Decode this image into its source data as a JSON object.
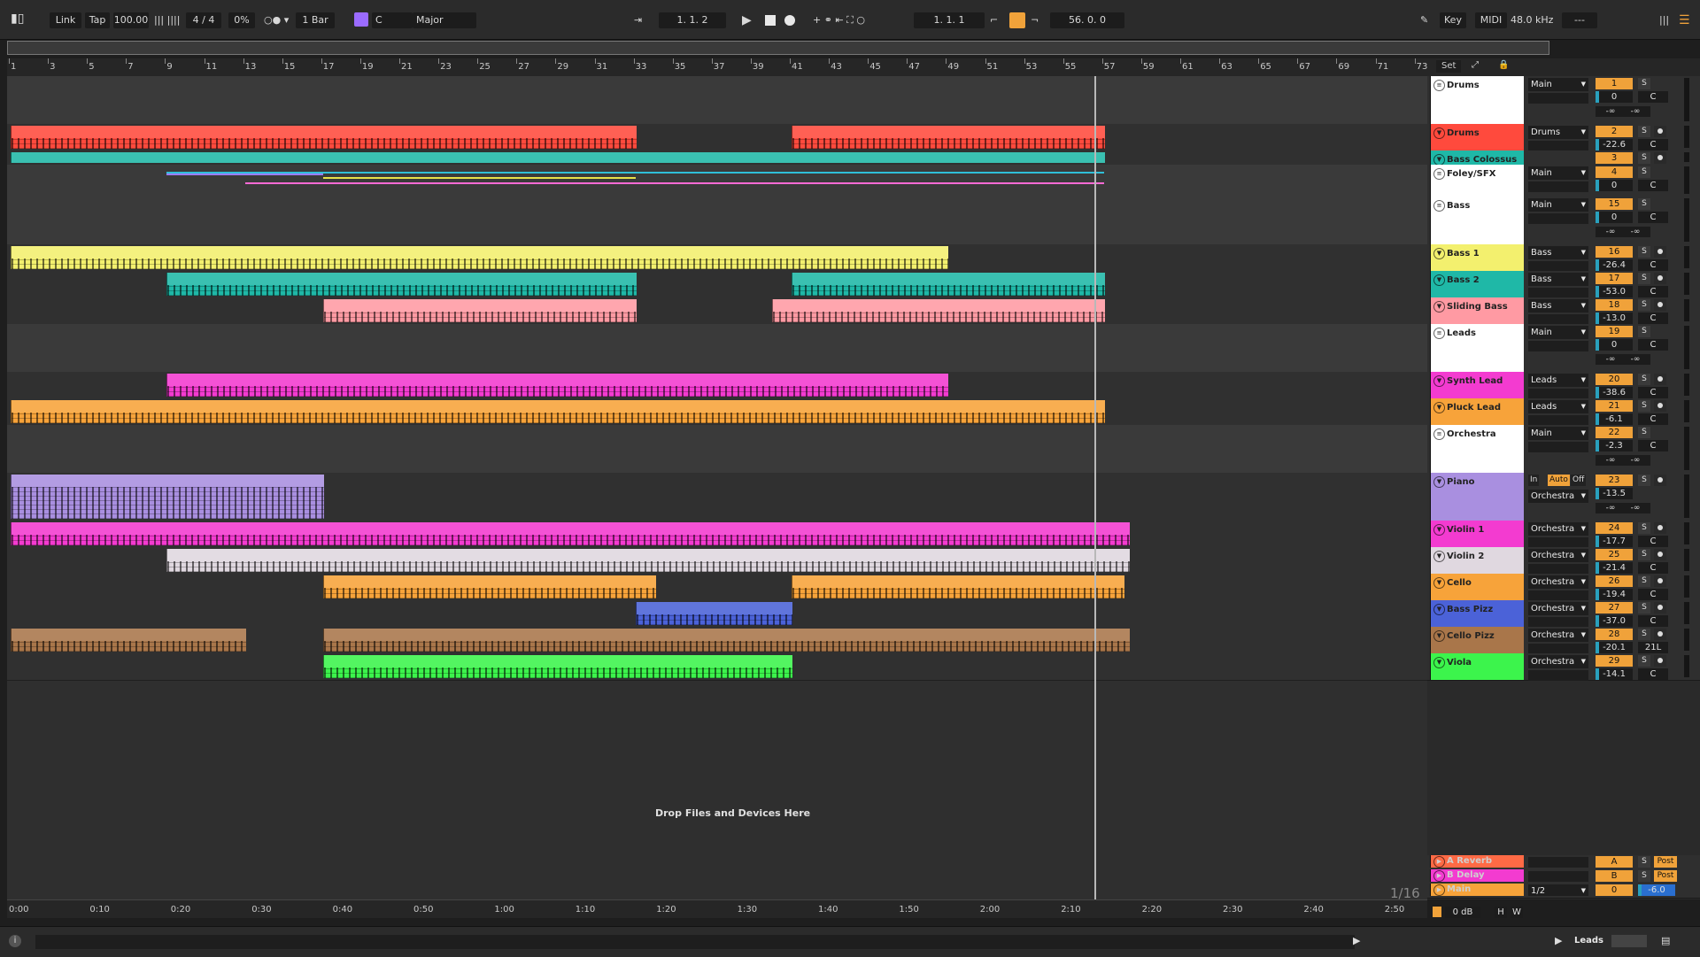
{
  "colors": {
    "accent": "#f0a23a",
    "selection": "#29a0bd"
  },
  "transport": {
    "link": "Link",
    "tap": "Tap",
    "tempo": "100.00",
    "time_signature": "4 / 4",
    "groove": "0%",
    "quantize": "1 Bar",
    "key": "C",
    "scale": "Major",
    "arrangement_position": "1.  1.  2",
    "loop_start": "1.  1.  1",
    "loop_length": "56.  0.  0",
    "key_button": "Key",
    "midi_button": "MIDI",
    "sample_rate": "48.0 kHz",
    "cpu": "---"
  },
  "ruler": {
    "bars": [
      "1",
      "3",
      "5",
      "7",
      "9",
      "11",
      "13",
      "15",
      "17",
      "19",
      "21",
      "23",
      "25",
      "27",
      "29",
      "31",
      "33",
      "35",
      "37",
      "39",
      "41",
      "43",
      "45",
      "47",
      "49",
      "51",
      "53",
      "55",
      "57",
      "59",
      "61",
      "63",
      "65",
      "67",
      "69",
      "71",
      "73"
    ]
  },
  "timeline": {
    "times": [
      "0:00",
      "0:10",
      "0:20",
      "0:30",
      "0:40",
      "0:50",
      "1:00",
      "1:10",
      "1:20",
      "1:30",
      "1:40",
      "1:50",
      "2:00",
      "2:10",
      "2:20",
      "2:30",
      "2:40",
      "2:50"
    ]
  },
  "set_label": "Set",
  "drop_hint": "Drop Files and Devices Here",
  "grid_label": "1/16",
  "tracks": [
    {
      "name": "Drums",
      "type": "group",
      "color": "#ffffff",
      "route": "Main",
      "num": "1",
      "vol": "0",
      "pan": "C",
      "inf": [
        "-∞",
        "-∞"
      ]
    },
    {
      "name": "Drums",
      "type": "midi",
      "color": "#ff4a3d",
      "route": "Drums",
      "num": "2",
      "vol": "-22.6",
      "pan": "C"
    },
    {
      "name": "Bass Colossus",
      "type": "midi",
      "color": "#1fb8a7",
      "route": "",
      "num": "3",
      "vol": "",
      "pan": ""
    },
    {
      "name": "Foley/SFX",
      "type": "group",
      "color": "#ffffff",
      "route": "Main",
      "num": "4",
      "vol": "0",
      "pan": "C"
    },
    {
      "name": "Bass",
      "type": "group",
      "color": "#ffffff",
      "route": "Main",
      "num": "15",
      "vol": "0",
      "pan": "C",
      "inf": [
        "-∞",
        "-∞"
      ]
    },
    {
      "name": "Bass 1",
      "type": "midi",
      "color": "#f3f06e",
      "route": "Bass",
      "num": "16",
      "vol": "-26.4",
      "pan": "C"
    },
    {
      "name": "Bass 2",
      "type": "midi",
      "color": "#1fb8a7",
      "route": "Bass",
      "num": "17",
      "vol": "-53.0",
      "pan": "C"
    },
    {
      "name": "Sliding Bass",
      "type": "midi",
      "color": "#ff9aa3",
      "route": "Bass",
      "num": "18",
      "vol": "-13.0",
      "pan": "C"
    },
    {
      "name": "Leads",
      "type": "group",
      "color": "#ffffff",
      "route": "Main",
      "num": "19",
      "vol": "0",
      "pan": "C",
      "inf": [
        "-∞",
        "-∞"
      ]
    },
    {
      "name": "Synth Lead",
      "type": "midi",
      "color": "#f33bd0",
      "route": "Leads",
      "num": "20",
      "vol": "-38.6",
      "pan": "C"
    },
    {
      "name": "Pluck Lead",
      "type": "midi",
      "color": "#f7a33a",
      "route": "Leads",
      "num": "21",
      "vol": "-6.1",
      "pan": "C"
    },
    {
      "name": "Orchestra",
      "type": "group",
      "color": "#ffffff",
      "route": "Main",
      "num": "22",
      "vol": "-2.3",
      "pan": "C",
      "inf": [
        "-∞",
        "-∞"
      ]
    },
    {
      "name": "Piano",
      "type": "midi",
      "color": "#a98fe0",
      "route": "Orchestra",
      "num": "23",
      "vol": "-13.5",
      "pan": "",
      "monitor": [
        "In",
        "Auto",
        "Off"
      ],
      "inf": [
        "-∞",
        "-∞"
      ]
    },
    {
      "name": "Violin 1",
      "type": "midi",
      "color": "#f33bd0",
      "route": "Orchestra",
      "num": "24",
      "vol": "-17.7",
      "pan": "C"
    },
    {
      "name": "Violin 2",
      "type": "midi",
      "color": "#e0d8e0",
      "route": "Orchestra",
      "num": "25",
      "vol": "-21.4",
      "pan": "C"
    },
    {
      "name": "Cello",
      "type": "midi",
      "color": "#f7a33a",
      "route": "Orchestra",
      "num": "26",
      "vol": "-19.4",
      "pan": "C"
    },
    {
      "name": "Bass Pizz",
      "type": "midi",
      "color": "#4b62d8",
      "route": "Orchestra",
      "num": "27",
      "vol": "-37.0",
      "pan": "C"
    },
    {
      "name": "Cello Pizz",
      "type": "midi",
      "color": "#a9764a",
      "route": "Orchestra",
      "num": "28",
      "vol": "-20.1",
      "pan": "21L"
    },
    {
      "name": "Viola",
      "type": "midi",
      "color": "#3cf44c",
      "route": "Orchestra",
      "num": "29",
      "vol": "-14.1",
      "pan": "C"
    }
  ],
  "returns": [
    {
      "name": "A Reverb",
      "color": "#ff6a45",
      "num": "A",
      "post": "Post"
    },
    {
      "name": "B Delay",
      "color": "#f33bd0",
      "num": "B",
      "post": "Post"
    },
    {
      "name": "Main",
      "color": "#f7a33a",
      "num": "0",
      "route": "1/2",
      "vol": "-6.0"
    }
  ],
  "master_db": "0 dB",
  "status": {
    "selected_track": "Leads",
    "h_button": "H",
    "w_button": "W"
  }
}
